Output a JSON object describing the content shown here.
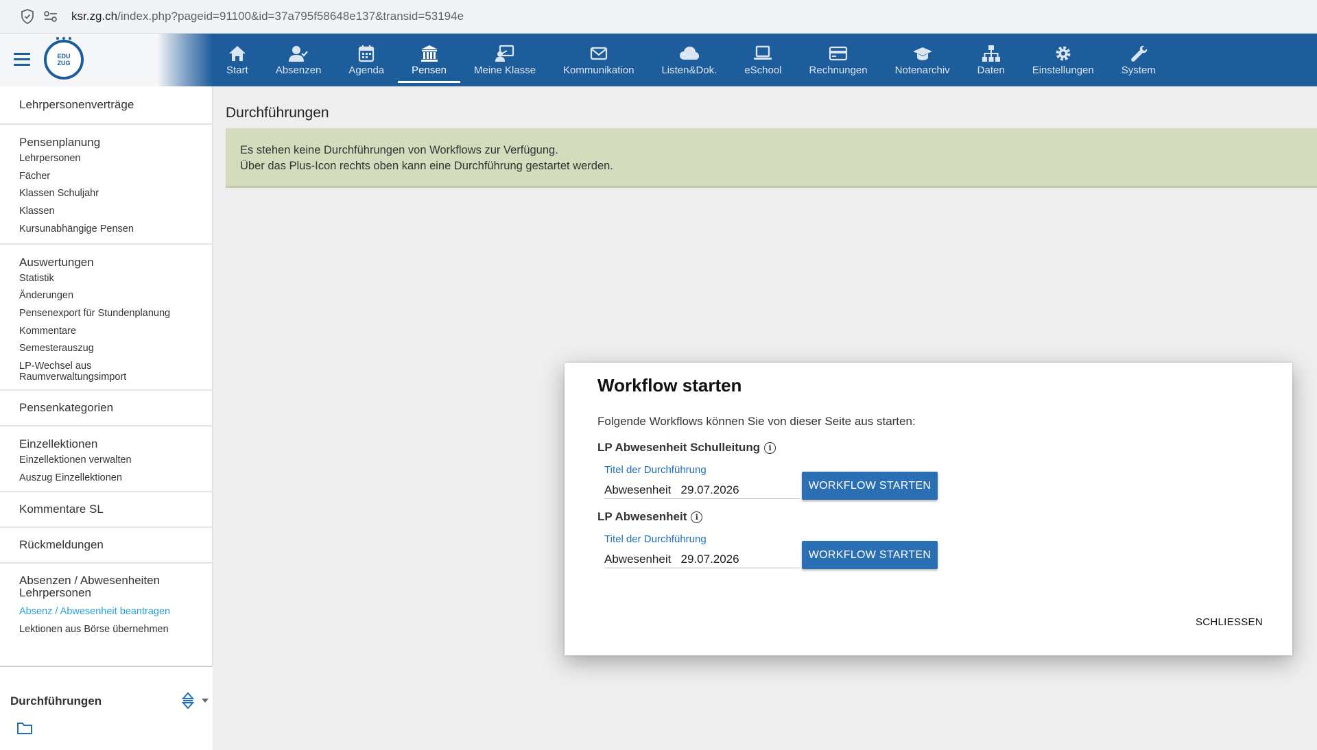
{
  "browser": {
    "url_host": "ksr.zg.ch",
    "url_path": "/index.php?pageid=91100&id=37a795f58648e137&transid=53194e"
  },
  "header": {
    "logo_line1": "EDU",
    "logo_line2": "ZUG",
    "nav": [
      {
        "label": "Start",
        "icon": "home-icon"
      },
      {
        "label": "Absenzen",
        "icon": "user-check-icon"
      },
      {
        "label": "Agenda",
        "icon": "calendar-icon"
      },
      {
        "label": "Pensen",
        "icon": "bank-icon",
        "active": true
      },
      {
        "label": "Meine Klasse",
        "icon": "presentation-icon"
      },
      {
        "label": "Kommunikation",
        "icon": "mail-icon"
      },
      {
        "label": "Listen&Dok.",
        "icon": "cloud-icon"
      },
      {
        "label": "eSchool",
        "icon": "laptop-icon"
      },
      {
        "label": "Rechnungen",
        "icon": "credit-card-icon"
      },
      {
        "label": "Notenarchiv",
        "icon": "graduation-cap-icon"
      },
      {
        "label": "Daten",
        "icon": "sitemap-icon"
      },
      {
        "label": "Einstellungen",
        "icon": "gear-icon"
      },
      {
        "label": "System",
        "icon": "wrench-icon"
      }
    ]
  },
  "sidebar": {
    "lehrpersonenvertraege": "Lehrpersonenverträge",
    "pensenplanung": {
      "title": "Pensenplanung",
      "links": [
        "Lehrpersonen",
        "Fächer",
        "Klassen Schuljahr",
        "Klassen",
        "Kursunabhängige Pensen"
      ]
    },
    "auswertungen": {
      "title": "Auswertungen",
      "links": [
        "Statistik",
        "Änderungen",
        "Pensenexport für Stundenplanung",
        "Kommentare",
        "Semesterauszug"
      ],
      "multi_line_link": [
        "LP-Wechsel aus",
        "Raumverwaltungsimport"
      ]
    },
    "pensenkategorien": "Pensenkategorien",
    "einzellektionen": {
      "title": "Einzellektionen",
      "links": [
        "Einzellektionen verwalten",
        "Auszug Einzellektionen"
      ]
    },
    "kommentare_sl": "Kommentare SL",
    "rueckmeldungen": "Rückmeldungen",
    "absenzen": {
      "title_line1": "Absenzen / Abwesenheiten",
      "title_line2": "Lehrpersonen",
      "active_link": "Absenz / Abwesenheit beantragen",
      "link": "Lektionen aus Börse übernehmen"
    },
    "durchfuehrungen_panel": "Durchführungen"
  },
  "main": {
    "title": "Durchführungen",
    "notice_line1": "Es stehen keine Durchführungen von Workflows zur Verfügung.",
    "notice_line2": "Über das Plus-Icon rechts oben kann eine Durchführung gestartet werden."
  },
  "modal": {
    "title": "Workflow starten",
    "intro": "Folgende Workflows können Sie von dieser Seite aus starten:",
    "workflows": [
      {
        "name": "LP Abwesenheit Schulleitung",
        "field_label": "Titel der Durchführung",
        "field_value": "Abwesenheit   29.07.2026",
        "button": "WORKFLOW STARTEN"
      },
      {
        "name": "LP Abwesenheit",
        "field_label": "Titel der Durchführung",
        "field_value": "Abwesenheit   29.07.2026",
        "button": "WORKFLOW STARTEN"
      }
    ],
    "close": "SCHLIESSEN"
  }
}
